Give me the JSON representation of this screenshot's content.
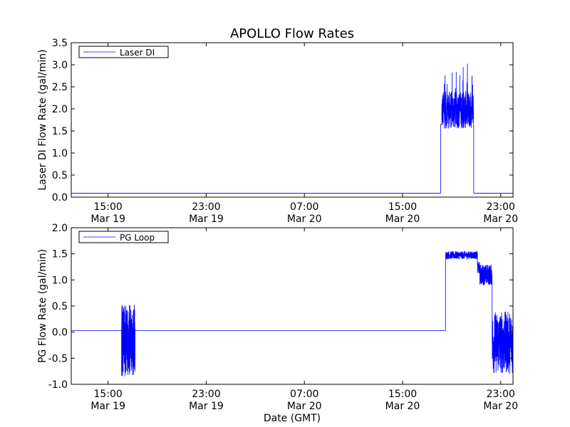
{
  "figure": {
    "title": "APOLLO Flow Rates",
    "xlabel": "Date (GMT)"
  },
  "colors": {
    "line": "#0000ff",
    "axes": "#000000",
    "background": "#ffffff"
  },
  "x_ticks": [
    {
      "t": 15,
      "time": "15:00",
      "date": "Mar 19"
    },
    {
      "t": 23,
      "time": "23:00",
      "date": "Mar 19"
    },
    {
      "t": 31,
      "time": "07:00",
      "date": "Mar 20"
    },
    {
      "t": 39,
      "time": "15:00",
      "date": "Mar 20"
    },
    {
      "t": 47,
      "time": "23:00",
      "date": "Mar 20"
    }
  ],
  "chart_data": [
    {
      "type": "line",
      "title": "APOLLO Flow Rates",
      "ylabel": "Laser DI Flow Rate (gal/min)",
      "ylim": [
        0,
        3.5
      ],
      "yticks": [
        "0.0",
        "0.5",
        "1.0",
        "1.5",
        "2.0",
        "2.5",
        "3.0",
        "3.5"
      ],
      "xlim_hours_from_Mar19_00": [
        12.0,
        48.0
      ],
      "legend": {
        "location": "upper-left"
      },
      "series": [
        {
          "name": "Laser DI",
          "segments": [
            {
              "start": 12.0,
              "end": 42.1,
              "mode": "flat",
              "value": 0.09
            },
            {
              "start": 42.1,
              "end": 42.2,
              "mode": "flat",
              "value": 1.65
            },
            {
              "start": 42.2,
              "end": 44.8,
              "mode": "noisy",
              "low": 1.55,
              "high": 2.4,
              "spike_high": 3.05
            },
            {
              "start": 44.8,
              "end": 48.0,
              "mode": "flat",
              "value": 0.09
            }
          ]
        }
      ]
    },
    {
      "type": "line",
      "ylabel": "PG Flow Rate (gal/min)",
      "ylim": [
        -1.0,
        2.0
      ],
      "yticks": [
        "-1.0",
        "-0.5",
        "0.0",
        "0.5",
        "1.0",
        "1.5",
        "2.0"
      ],
      "xlim_hours_from_Mar19_00": [
        12.0,
        48.0
      ],
      "legend": {
        "location": "upper-left"
      },
      "series": [
        {
          "name": "PG Loop",
          "segments": [
            {
              "start": 12.0,
              "end": 16.1,
              "mode": "flat",
              "value": 0.03
            },
            {
              "start": 16.1,
              "end": 17.2,
              "mode": "noisy",
              "low": -0.8,
              "high": 0.5,
              "spike_low": -0.85,
              "spike_high": 0.52
            },
            {
              "start": 17.2,
              "end": 42.5,
              "mode": "flat",
              "value": 0.03
            },
            {
              "start": 42.5,
              "end": 45.1,
              "mode": "noisy",
              "low": 1.4,
              "high": 1.55
            },
            {
              "start": 45.1,
              "end": 45.3,
              "mode": "noisy",
              "low": 1.1,
              "high": 1.35
            },
            {
              "start": 45.3,
              "end": 46.3,
              "mode": "noisy",
              "low": 0.9,
              "high": 1.3
            },
            {
              "start": 46.3,
              "end": 48.0,
              "mode": "noisy",
              "low": -0.8,
              "high": 0.4
            }
          ]
        }
      ]
    }
  ]
}
